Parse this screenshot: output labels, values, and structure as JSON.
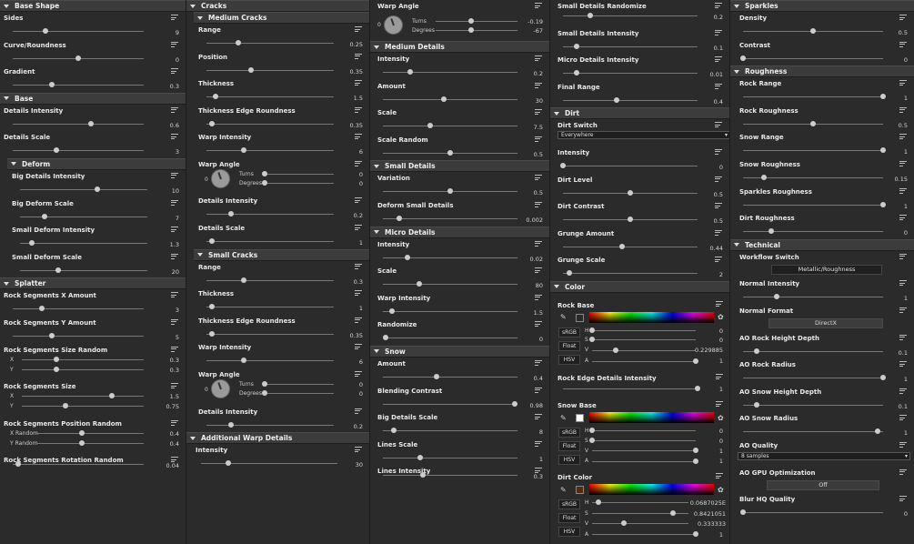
{
  "col1": {
    "base_shape": "Base Shape",
    "sides": {
      "label": "Sides",
      "value": "9"
    },
    "curve": {
      "label": "Curve/Roundness",
      "value": "0"
    },
    "gradient": {
      "label": "Gradient",
      "value": "0.3"
    },
    "base": "Base",
    "details_intensity": {
      "label": "Details Intensity",
      "value": "0.6"
    },
    "details_scale": {
      "label": "Details Scale",
      "value": "3"
    },
    "deform": "Deform",
    "big_details_intensity": {
      "label": "Big Details Intensity",
      "value": "10"
    },
    "big_deform_scale": {
      "label": "Big Deform Scale",
      "value": "7"
    },
    "small_deform_intensity": {
      "label": "Small Deform Intensity",
      "value": "1.3"
    },
    "small_deform_scale": {
      "label": "Small Deform Scale",
      "value": "20"
    },
    "splatter": "Splatter",
    "rs_x": {
      "label": "Rock Segments X Amount",
      "value": "3"
    },
    "rs_y": {
      "label": "Rock Segments Y Amount",
      "value": "5"
    },
    "rs_size_random": {
      "label": "Rock Segments Size Random",
      "x": "X",
      "y": "Y",
      "vx": "0.3",
      "vy": "0.3"
    },
    "rs_size": {
      "label": "Rock Segments Size",
      "x": "X",
      "y": "Y",
      "vx": "1.5",
      "vy": "0.75"
    },
    "rs_pos_random": {
      "label": "Rock Segments Position Random",
      "x": "X Random",
      "y": "Y Random",
      "vx": "0.4",
      "vy": "0.4"
    },
    "rs_rot_random": {
      "label": "Rock Segments Rotation Random",
      "value": "0.04"
    }
  },
  "col2": {
    "cracks": "Cracks",
    "medium_cracks": "Medium Cracks",
    "range": {
      "label": "Range",
      "value": "0.25"
    },
    "position": {
      "label": "Position",
      "value": "0.35"
    },
    "thickness": {
      "label": "Thickness",
      "value": "1.5"
    },
    "thickness_edge": {
      "label": "Thickness Edge Roundness",
      "value": "0.35"
    },
    "warp_intensity": {
      "label": "Warp Intensity",
      "value": "6"
    },
    "warp_angle": {
      "label": "Warp Angle",
      "zero": "0",
      "turns": "Turns",
      "degrees": "Degrees",
      "vt": "0",
      "vd": "0"
    },
    "details_intensity": {
      "label": "Details Intensity",
      "value": "0.2"
    },
    "details_scale": {
      "label": "Details Scale",
      "value": "1"
    },
    "small_cracks": "Small Cracks",
    "s_range": {
      "label": "Range",
      "value": "0.3"
    },
    "s_thickness": {
      "label": "Thickness",
      "value": "1"
    },
    "s_thickness_edge": {
      "label": "Thickness Edge Roundness",
      "value": "0.35"
    },
    "s_warp_intensity": {
      "label": "Warp Intensity",
      "value": "6"
    },
    "s_warp_angle": {
      "label": "Warp Angle",
      "zero": "0",
      "turns": "Turns",
      "degrees": "Degrees",
      "vt": "0",
      "vd": "0"
    },
    "s_details_intensity": {
      "label": "Details Intensity",
      "value": "0.2"
    },
    "additional_warp": "Additional Warp Details",
    "intensity": {
      "label": "Intensity",
      "value": "30"
    }
  },
  "col3": {
    "warp_angle": {
      "label": "Warp Angle",
      "zero": "0",
      "turns": "Turns",
      "degrees": "Degrees",
      "vt": "-0.19",
      "vd": "-67"
    },
    "medium_details": "Medium Details",
    "md_intensity": {
      "label": "Intensity",
      "value": "0.2"
    },
    "md_amount": {
      "label": "Amount",
      "value": "30"
    },
    "md_scale": {
      "label": "Scale",
      "value": "7.5"
    },
    "md_scale_random": {
      "label": "Scale Random",
      "value": "0.5"
    },
    "small_details": "Small Details",
    "sd_variation": {
      "label": "Variation",
      "value": "0.5"
    },
    "sd_deform": {
      "label": "Deform Small Details",
      "value": "0.002"
    },
    "micro_details": "Micro Details",
    "mi_intensity": {
      "label": "Intensity",
      "value": "0.02"
    },
    "mi_scale": {
      "label": "Scale",
      "value": "80"
    },
    "mi_warp": {
      "label": "Warp Intensity",
      "value": "1.5"
    },
    "mi_randomize": {
      "label": "Randomize",
      "value": "0"
    },
    "snow": "Snow",
    "sn_amount": {
      "label": "Amount",
      "value": "0.4"
    },
    "sn_blend": {
      "label": "Blending Contrast",
      "value": "0.98"
    },
    "sn_big": {
      "label": "Big Details Scale",
      "value": "8"
    },
    "sn_lines_scale": {
      "label": "Lines Scale",
      "value": "1"
    },
    "sn_lines_int": {
      "label": "Lines Intensity",
      "value": "0.3"
    }
  },
  "col4": {
    "sd_randomize": {
      "label": "Small Details Randomize",
      "value": "0.2"
    },
    "sd_intensity": {
      "label": "Small Details Intensity",
      "value": "0.1"
    },
    "md_intensity": {
      "label": "Micro Details Intensity",
      "value": "0.01"
    },
    "final_range": {
      "label": "Final Range",
      "value": "0.4"
    },
    "dirt": "Dirt",
    "dirt_switch": {
      "label": "Dirt Switch",
      "value": "Everywhere"
    },
    "d_intensity": {
      "label": "Intensity",
      "value": "0"
    },
    "d_level": {
      "label": "Dirt Level",
      "value": "0.5"
    },
    "d_contrast": {
      "label": "Dirt Contrast",
      "value": "0.5"
    },
    "grunge_amount": {
      "label": "Grunge Amount",
      "value": "0.44"
    },
    "grunge_scale": {
      "label": "Grunge Scale",
      "value": "2"
    },
    "color": "Color",
    "rock_base": {
      "label": "Rock Base",
      "h": "H",
      "s": "S",
      "v": "V",
      "a": "A",
      "srgb": "sRGB",
      "float": "Float",
      "hsv": "HSV",
      "vh": "0",
      "vs": "0",
      "vv": "0.229885",
      "va": "1"
    },
    "rock_edge": {
      "label": "Rock Edge Details Intensity",
      "value": "1"
    },
    "snow_base": {
      "label": "Snow Base",
      "h": "H",
      "s": "S",
      "v": "V",
      "a": "A",
      "srgb": "sRGB",
      "float": "Float",
      "hsv": "HSV",
      "vh": "0",
      "vs": "0",
      "vv": "1",
      "va": "1"
    },
    "dirt_color": {
      "label": "Dirt Color",
      "h": "H",
      "s": "S",
      "v": "V",
      "a": "A",
      "srgb": "sRGB",
      "float": "Float",
      "hsv": "HSV",
      "vh": "0.0687025E",
      "vs": "0.8421051",
      "vv": "0.333333",
      "va": "1"
    }
  },
  "col5": {
    "sparkles": "Sparkles",
    "density": {
      "label": "Density",
      "value": "0.5"
    },
    "contrast": {
      "label": "Contrast",
      "value": "0"
    },
    "roughness": "Roughness",
    "rock_range": {
      "label": "Rock Range",
      "value": "1"
    },
    "rock_roughness": {
      "label": "Rock Roughness",
      "value": "0.5"
    },
    "snow_range": {
      "label": "Snow Range",
      "value": "1"
    },
    "snow_roughness": {
      "label": "Snow Roughness",
      "value": "0.15"
    },
    "sparkles_roughness": {
      "label": "Sparkles Roughness",
      "value": "1"
    },
    "dirt_roughness": {
      "label": "Dirt Roughness",
      "value": "0"
    },
    "technical": "Technical",
    "workflow": {
      "label": "Workflow Switch",
      "value": "Metallic/Roughness"
    },
    "normal_intensity": {
      "label": "Normal Intensity",
      "value": "1"
    },
    "normal_format": {
      "label": "Normal Format",
      "value": "DirectX"
    },
    "ao_rock_height": {
      "label": "AO Rock Height Depth",
      "value": "0.1"
    },
    "ao_rock_radius": {
      "label": "AO Rock Radius",
      "value": "1"
    },
    "ao_snow_height": {
      "label": "AO Snow Height Depth",
      "value": "0.1"
    },
    "ao_snow_radius": {
      "label": "AO Snow Radius",
      "value": "1"
    },
    "ao_quality": {
      "label": "AO Quality",
      "value": "8 samples"
    },
    "ao_gpu": {
      "label": "AO GPU Optimization",
      "value": "Off"
    },
    "blur_hq": {
      "label": "Blur HQ Quality",
      "value": "0"
    }
  },
  "colors": {
    "rock_base": "#2a2a2a",
    "snow_base": "#ffffff",
    "dirt_color": "#552a0d"
  },
  "fills": {
    "sides": 0.25,
    "curve": 0.5,
    "gradient": 0.3,
    "details_intensity": 0.6,
    "details_scale": 0.33,
    "big_details_intensity": 0.52,
    "big_deform_scale": 0.15,
    "small_deform_intensity": 0.08,
    "small_deform_scale": 0.22,
    "rs_x": 0.2,
    "rs_y": 0.25,
    "rs_size_random_x": 0.3,
    "rs_size_random_y": 0.3,
    "rs_size_x": 0.75,
    "rs_size_y": 0.37,
    "rs_pos_random_x": 0.4,
    "rs_pos_random_y": 0.4,
    "rs_rot_random": 0.04
  }
}
